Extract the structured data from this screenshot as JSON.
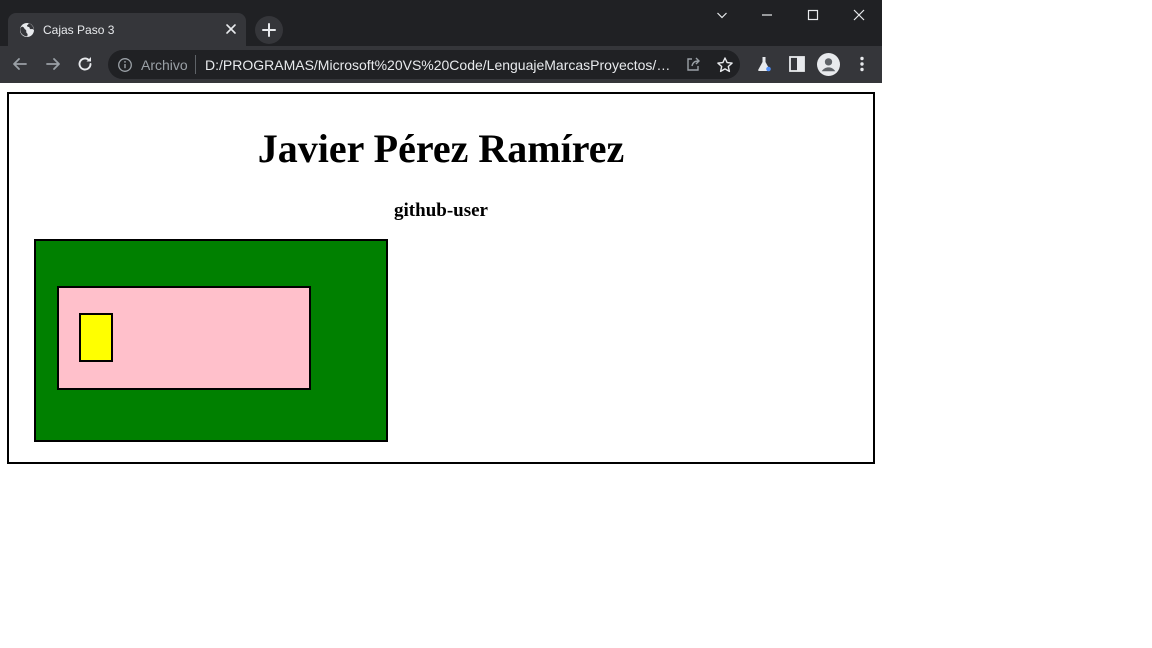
{
  "browser": {
    "tab": {
      "title": "Cajas Paso 3",
      "favicon": "globe-icon"
    },
    "omnibox": {
      "security_label": "Archivo",
      "url": "D:/PROGRAMAS/Microsoft%20VS%20Code/LenguajeMarcasProyectos/caj..."
    },
    "icons": {
      "back": "arrow-left-icon",
      "forward": "arrow-right-icon",
      "reload": "reload-icon",
      "share": "share-icon",
      "bookmark": "star-icon",
      "labs": "flask-icon",
      "side_panel": "side-panel-icon",
      "profile": "avatar-icon",
      "menu": "kebab-menu-icon"
    }
  },
  "page": {
    "title": "Javier Pérez Ramírez",
    "subtitle": "github-user",
    "colors": {
      "outer": "#ffffff",
      "green_box": "#008000",
      "pink_box": "#ffc0cb",
      "yellow_box": "#ffff00",
      "border": "#000000"
    }
  }
}
